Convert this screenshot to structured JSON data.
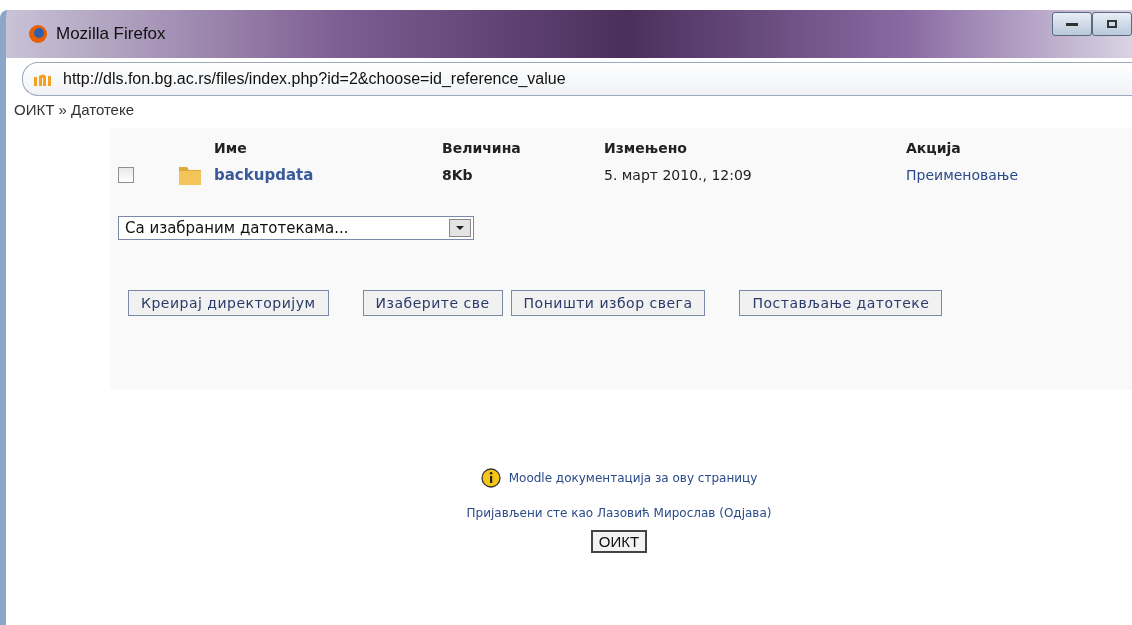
{
  "window": {
    "title": "Mozilla Firefox"
  },
  "address_bar": {
    "url": "http://dls.fon.bg.ac.rs/files/index.php?id=2&choose=id_reference_value"
  },
  "breadcrumb": "ОИКТ » Датотеке",
  "table": {
    "columns": [
      "Име",
      "Величина",
      "Измењено",
      "Акција"
    ],
    "rows": [
      {
        "checked": false,
        "name": "backupdata",
        "size": "8Kb",
        "modified": "5. март 2010., 12:09",
        "action": "Преименовање"
      }
    ]
  },
  "with_selected": {
    "value": "Са изабраним датотекама..."
  },
  "buttons": [
    "Креирај директоријум",
    "Изаберите све",
    "Поништи избор свега",
    "Постављање датотеке"
  ],
  "footer": {
    "docs_link": "Moodle документација за ову страницу",
    "login_info": "Пријављени сте као Лазовић Мирослав (Одјава)",
    "home_button": "ОИКТ"
  }
}
